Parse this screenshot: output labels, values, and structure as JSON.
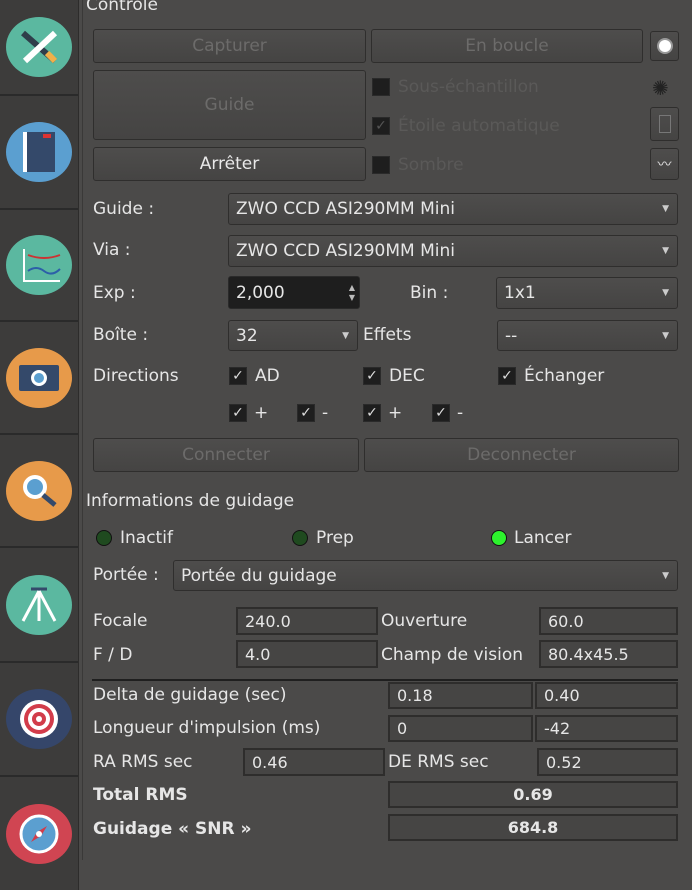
{
  "sidebar": {
    "tabs": [
      "setup",
      "scheduler",
      "analyze",
      "capture",
      "focus",
      "mount",
      "align",
      "guide"
    ]
  },
  "control": {
    "title": "Contrôle",
    "capture": "Capturer",
    "loop": "En boucle",
    "guide": "Guide",
    "stop": "Arrêter",
    "subframe": "Sous-échantillon",
    "autostar": "Étoile automatique",
    "dark": "Sombre",
    "guide_label": "Guide :",
    "guide_value": "ZWO CCD ASI290MM Mini",
    "via_label": "Via :",
    "via_value": "ZWO CCD ASI290MM Mini",
    "exp_label": "Exp :",
    "exp_value": "2,000",
    "bin_label": "Bin :",
    "bin_value": "1x1",
    "box_label": "Boîte :",
    "box_value": "32",
    "effects_label": "Effets",
    "effects_value": "--",
    "directions_label": "Directions",
    "ra": "AD",
    "dec": "DEC",
    "swap": "Échanger",
    "plus": "+",
    "minus": "-",
    "connect": "Connecter",
    "disconnect": "Deconnecter"
  },
  "info": {
    "title": "Informations de guidage",
    "idle": "Inactif",
    "prep": "Prep",
    "run": "Lancer",
    "scope_label": "Portée :",
    "scope_value": "Portée du guidage",
    "focal_label": "Focale",
    "focal": "240.0",
    "aperture_label": "Ouverture",
    "aperture": "60.0",
    "fd_label": "F / D",
    "fd": "4.0",
    "fov_label": "Champ de vision",
    "fov": "80.4x45.5",
    "delta_label": "Delta de guidage (sec)",
    "delta_ra": "0.18",
    "delta_de": "0.40",
    "pulse_label": "Longueur d'impulsion (ms)",
    "pulse_ra": "0",
    "pulse_de": "-42",
    "ra_rms_label": "RA RMS sec",
    "ra_rms": "0.46",
    "de_rms_label": "DE RMS sec",
    "de_rms": "0.52",
    "total_rms_label": "Total RMS",
    "total_rms": "0.69",
    "snr_label": "Guidage « SNR »",
    "snr": "684.8"
  }
}
